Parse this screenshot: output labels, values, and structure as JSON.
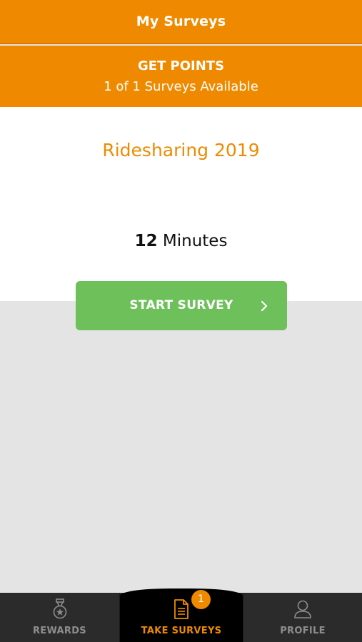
{
  "header": {
    "title": "My Surveys"
  },
  "points_banner": {
    "title": "GET POINTS",
    "subtitle": "1 of 1 Surveys Available"
  },
  "survey": {
    "name": "Ridesharing 2019",
    "duration_value": "12",
    "duration_unit": "Minutes",
    "start_label": "START SURVEY"
  },
  "tabbar": {
    "tabs": [
      {
        "label": "REWARDS",
        "icon": "medal-icon",
        "active": false
      },
      {
        "label": "TAKE SURVEYS",
        "icon": "document-icon",
        "active": true,
        "badge": "1"
      },
      {
        "label": "PROFILE",
        "icon": "person-icon",
        "active": false
      }
    ]
  },
  "colors": {
    "brand_orange": "#ef8a00",
    "start_green": "#6ec05a",
    "tabbar_bg": "#2b2b2b",
    "page_bg": "#e4e4e4"
  }
}
